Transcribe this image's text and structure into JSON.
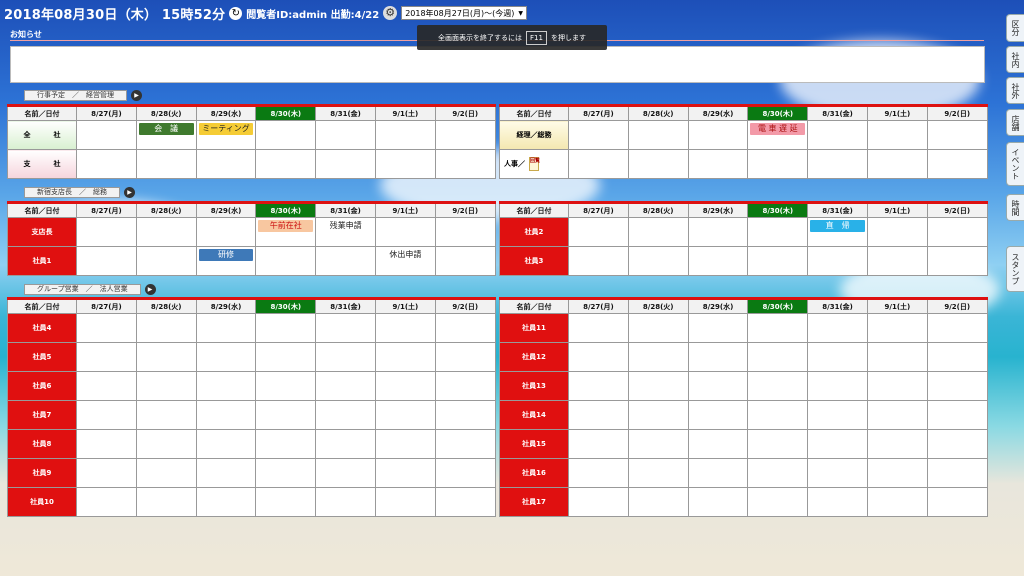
{
  "header": {
    "clock": "2018年08月30日（木） 15時52分",
    "viewer": "閲覧者ID:admin 出勤:4/22",
    "date_select": "2018年08月27日(月)〜(今週)"
  },
  "toast": {
    "before": "全画面表示を終了するには",
    "key": "F11",
    "after": "を押します"
  },
  "notice": {
    "label": "お知らせ"
  },
  "days": [
    {
      "label": "8/27(月)",
      "today": false
    },
    {
      "label": "8/28(火)",
      "today": false
    },
    {
      "label": "8/29(水)",
      "today": false
    },
    {
      "label": "8/30(木)",
      "today": true
    },
    {
      "label": "8/31(金)",
      "today": false
    },
    {
      "label": "9/1(土)",
      "today": false
    },
    {
      "label": "9/2(日)",
      "today": false
    }
  ],
  "name_header": "名前／日付",
  "sections": [
    {
      "label": "行事予定　／　経営管理",
      "left": [
        {
          "name": "全　社",
          "style": "green",
          "cells": [
            null,
            {
              "text": "会　議",
              "style": "green"
            },
            {
              "text": "ミーティング",
              "style": "yellow"
            },
            null,
            null,
            null,
            null
          ]
        },
        {
          "name": "支　社",
          "style": "pink",
          "cells": [
            null,
            null,
            null,
            null,
            null,
            null,
            null
          ]
        }
      ],
      "right": [
        {
          "name": "経理／総務",
          "style": "yellow",
          "cells": [
            null,
            null,
            null,
            {
              "text": "電 車 遅 延",
              "style": "pink"
            },
            null,
            null,
            null
          ]
        },
        {
          "name": "人事／",
          "style": "plain",
          "memo": "回覧",
          "cells": [
            null,
            null,
            null,
            null,
            null,
            null,
            null
          ]
        }
      ]
    },
    {
      "label": "新宿支店長　／　総務",
      "left": [
        {
          "name": "支店長",
          "style": "red",
          "cells": [
            null,
            null,
            null,
            {
              "text": "午前在社",
              "style": "salmon"
            },
            {
              "text": "残業申請",
              "style": "text"
            },
            null,
            null
          ]
        },
        {
          "name": "社員1",
          "style": "red",
          "cells": [
            null,
            null,
            {
              "text": "研修",
              "style": "blue"
            },
            null,
            null,
            {
              "text": "休出申請",
              "style": "text"
            },
            null
          ]
        }
      ],
      "right": [
        {
          "name": "社員2",
          "style": "red",
          "cells": [
            null,
            null,
            null,
            null,
            {
              "text": "直　帰",
              "style": "cyan"
            },
            null,
            null
          ]
        },
        {
          "name": "社員3",
          "style": "red",
          "cells": [
            null,
            null,
            null,
            null,
            null,
            null,
            null
          ]
        }
      ]
    },
    {
      "label": "グループ営業　／　法人営業",
      "left": [
        {
          "name": "社員4",
          "style": "red"
        },
        {
          "name": "社員5",
          "style": "red"
        },
        {
          "name": "社員6",
          "style": "red"
        },
        {
          "name": "社員7",
          "style": "red"
        },
        {
          "name": "社員8",
          "style": "red"
        },
        {
          "name": "社員9",
          "style": "red"
        },
        {
          "name": "社員10",
          "style": "red"
        }
      ],
      "right": [
        {
          "name": "社員11",
          "style": "red"
        },
        {
          "name": "社員12",
          "style": "red"
        },
        {
          "name": "社員13",
          "style": "red"
        },
        {
          "name": "社員14",
          "style": "red"
        },
        {
          "name": "社員15",
          "style": "red"
        },
        {
          "name": "社員16",
          "style": "red"
        },
        {
          "name": "社員17",
          "style": "red"
        }
      ]
    }
  ],
  "side_tabs": [
    "区分",
    "社内",
    "社外",
    "店舗",
    "イベント",
    "時間",
    "スタンプ"
  ],
  "icons": {
    "refresh": "refresh-icon",
    "settings": "gear-icon",
    "play": "play-icon",
    "memo": "memo-icon"
  },
  "colors": {
    "today": "#0a7a12",
    "name_red": "#e01010",
    "header_border": "#d11111"
  }
}
